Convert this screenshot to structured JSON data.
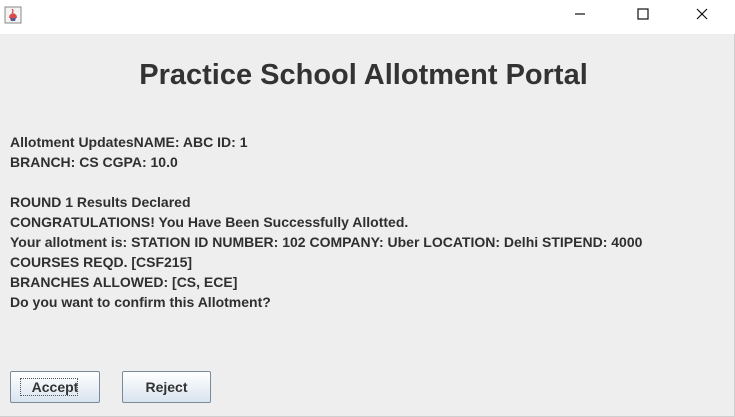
{
  "window": {
    "app_icon": "java-coffee-cup-icon",
    "controls": [
      "minimize-icon",
      "maximize-icon",
      "close-icon"
    ]
  },
  "header": {
    "title": "Practice School Allotment Portal"
  },
  "details": {
    "lines": [
      "Allotment UpdatesNAME: ABC ID: 1",
      "BRANCH: CS CGPA: 10.0",
      "",
      "ROUND 1 Results Declared",
      "CONGRATULATIONS! You Have Been Successfully Allotted.",
      "Your allotment is: STATION ID NUMBER: 102 COMPANY: Uber LOCATION: Delhi STIPEND: 4000",
      "COURSES REQD. [CSF215]",
      "BRANCHES ALLOWED: [CS, ECE]",
      "Do you want to confirm this Allotment?"
    ]
  },
  "actions": {
    "accept_label": "Accept",
    "reject_label": "Reject"
  },
  "colors": {
    "background": "#eeeeee",
    "titlebar": "#ffffff",
    "text": "#333333"
  }
}
